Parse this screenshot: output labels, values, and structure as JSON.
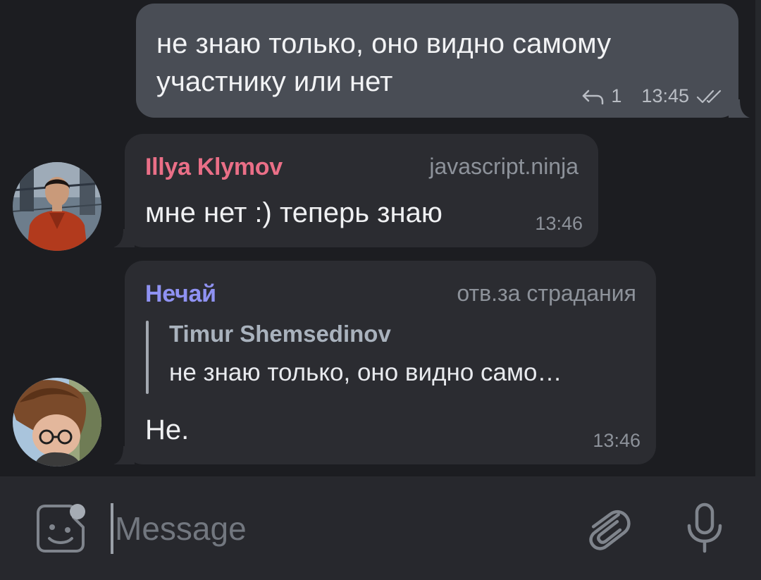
{
  "messages": {
    "outgoing": {
      "text": "не знаю только, оно видно самому\nучастнику или нет",
      "reply_count": "1",
      "time": "13:45",
      "status_icon": "double-check-icon"
    },
    "msg1": {
      "sender": "Illya Klymov",
      "sender_color": "#ea6f87",
      "badge": "javascript.ninja",
      "text": "мне нет :) теперь знаю",
      "time": "13:46"
    },
    "msg2": {
      "sender": "Нечай",
      "sender_color": "#8f92f2",
      "badge": "отв.за страдания",
      "reply_author": "Timur Shemsedinov",
      "reply_text": "не знаю только, оно видно само…",
      "text": "Не.",
      "time": "13:46"
    }
  },
  "composer": {
    "placeholder": "Message",
    "value": "",
    "left_icon": "sticker-emoji-icon",
    "attach_icon": "paperclip-icon",
    "mic_icon": "microphone-icon"
  },
  "colors": {
    "background": "#1c1d21",
    "outgoing_bubble": "#494d55",
    "incoming_bubble": "#2b2c31",
    "input_bar": "#27282d"
  }
}
